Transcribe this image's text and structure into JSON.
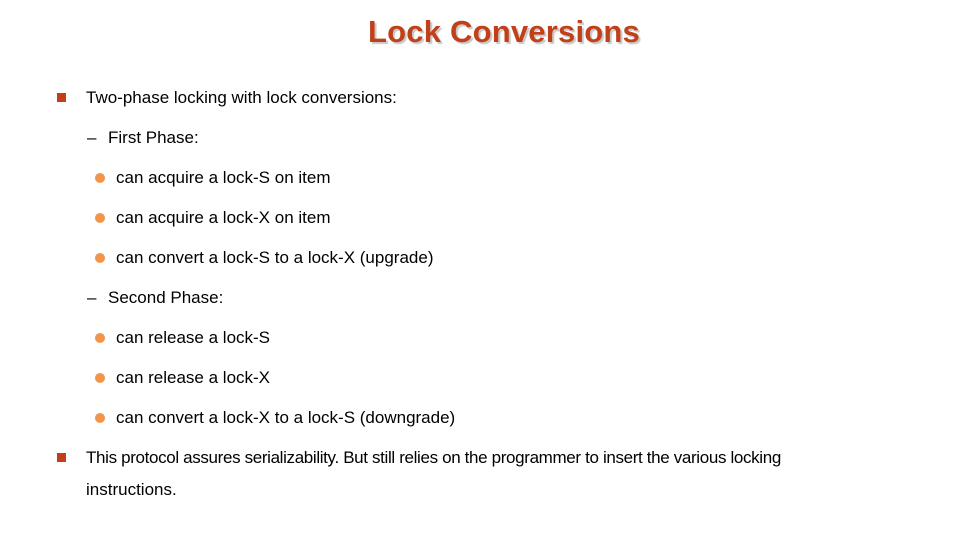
{
  "slide": {
    "title": "Lock Conversions",
    "colors": {
      "title": "#c1401a",
      "level1_bullet": "#c1401a",
      "level3_bullet": "#f0954a",
      "text": "#000000"
    },
    "bullets": [
      {
        "text": "Two-phase locking with lock conversions:",
        "children": [
          {
            "marker": "–",
            "text": "First Phase:",
            "children": [
              {
                "text": "can acquire a lock-S on item"
              },
              {
                "text": "can acquire a lock-X on item"
              },
              {
                "text": "can convert a lock-S to a lock-X (upgrade)"
              }
            ]
          },
          {
            "marker": "–",
            "text": "Second Phase:",
            "children": [
              {
                "text": "can release a lock-S"
              },
              {
                "text": "can release a lock-X"
              },
              {
                "text": "can convert a lock-X to a lock-S  (downgrade)"
              }
            ]
          }
        ]
      },
      {
        "text_line1": "This protocol assures serializability. But still relies on the programmer to insert the various  locking",
        "text_line2": "instructions."
      }
    ]
  }
}
